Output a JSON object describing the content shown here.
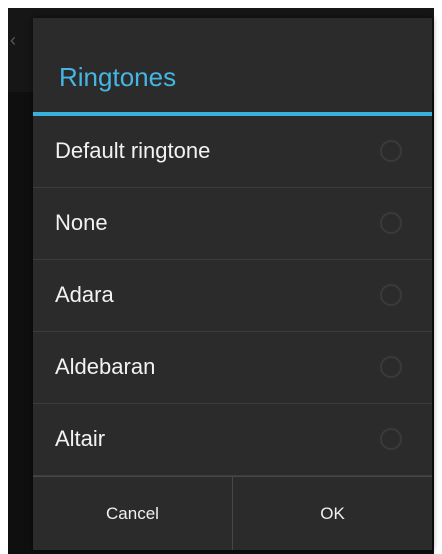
{
  "dialog": {
    "title": "Ringtones",
    "options": [
      {
        "label": "Default ringtone",
        "selected": false
      },
      {
        "label": "None",
        "selected": false
      },
      {
        "label": "Adara",
        "selected": false
      },
      {
        "label": "Aldebaran",
        "selected": false
      },
      {
        "label": "Altair",
        "selected": false
      }
    ],
    "buttons": {
      "cancel_label": "Cancel",
      "ok_label": "OK"
    }
  },
  "underlay": {
    "back_icon": "chevron-left-icon"
  },
  "colors": {
    "accent": "#45b6e3",
    "dialog_background": "#2b2b2b",
    "text": "#f2f2f2"
  }
}
